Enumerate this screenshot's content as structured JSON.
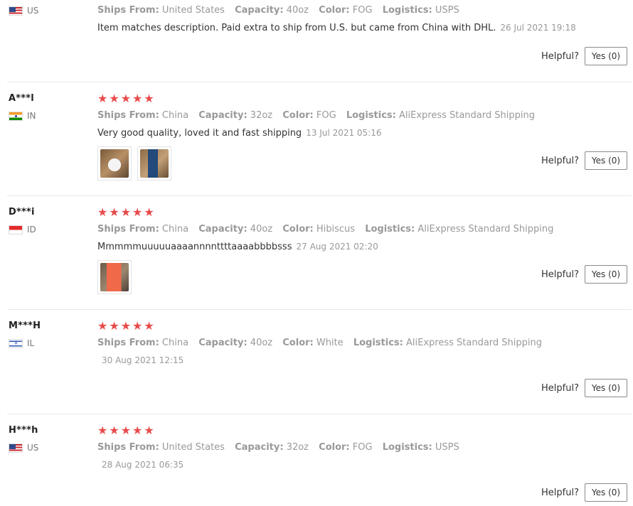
{
  "reviews": [
    {
      "user": "",
      "country": "US",
      "ships_from_label": "Ships From:",
      "ships_from": "United States",
      "capacity_label": "Capacity:",
      "capacity": "40oz",
      "color_label": "Color:",
      "color": "FOG",
      "logistics_label": "Logistics:",
      "logistics": "USPS",
      "text": "Item matches description. Paid extra to ship from U.S. but came from China with DHL.",
      "date": "26 Jul 2021 19:18",
      "helpful_label": "Helpful?",
      "yes_label": "Yes (0)"
    },
    {
      "user": "A***l",
      "country": "IN",
      "stars": "★★★★★",
      "ships_from_label": "Ships From:",
      "ships_from": "China",
      "capacity_label": "Capacity:",
      "capacity": "32oz",
      "color_label": "Color:",
      "color": "FOG",
      "logistics_label": "Logistics:",
      "logistics": "AliExpress Standard Shipping",
      "text": "Very good quality, loved it and fast shipping",
      "date": "13 Jul 2021 05:16",
      "helpful_label": "Helpful?",
      "yes_label": "Yes (0)"
    },
    {
      "user": "D***i",
      "country": "ID",
      "stars": "★★★★★",
      "ships_from_label": "Ships From:",
      "ships_from": "China",
      "capacity_label": "Capacity:",
      "capacity": "40oz",
      "color_label": "Color:",
      "color": "Hibiscus",
      "logistics_label": "Logistics:",
      "logistics": "AliExpress Standard Shipping",
      "text": "Mmmmmuuuuuaaaannnnttttaaaabbbbsss",
      "date": "27 Aug 2021 02:20",
      "helpful_label": "Helpful?",
      "yes_label": "Yes (0)"
    },
    {
      "user": "M***H",
      "country": "IL",
      "stars": "★★★★★",
      "ships_from_label": "Ships From:",
      "ships_from": "China",
      "capacity_label": "Capacity:",
      "capacity": "40oz",
      "color_label": "Color:",
      "color": "White",
      "logistics_label": "Logistics:",
      "logistics": "AliExpress Standard Shipping",
      "text": "",
      "date": "30 Aug 2021 12:15",
      "helpful_label": "Helpful?",
      "yes_label": "Yes (0)"
    },
    {
      "user": "H***h",
      "country": "US",
      "stars": "★★★★★",
      "ships_from_label": "Ships From:",
      "ships_from": "United States",
      "capacity_label": "Capacity:",
      "capacity": "32oz",
      "color_label": "Color:",
      "color": "FOG",
      "logistics_label": "Logistics:",
      "logistics": "USPS",
      "text": "",
      "date": "28 Aug 2021 06:35",
      "helpful_label": "Helpful?",
      "yes_label": "Yes (0)"
    }
  ],
  "colors": {
    "star": "#e84b4b",
    "divider": "#e8e8e8"
  },
  "icons": {
    "flag_us": "us-flag-icon",
    "flag_in": "india-flag-icon",
    "flag_id": "indonesia-flag-icon",
    "flag_il": "israel-flag-icon"
  }
}
